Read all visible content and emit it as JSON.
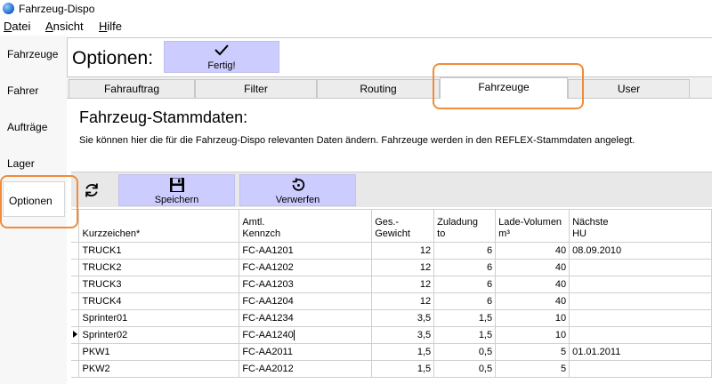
{
  "window": {
    "title": "Fahrzeug-Dispo"
  },
  "menu": [
    {
      "ul": "D",
      "rest": "atei"
    },
    {
      "ul": "A",
      "rest": "nsicht"
    },
    {
      "ul": "H",
      "rest": "ilfe"
    }
  ],
  "sidebar": {
    "items": [
      {
        "label": "Fahrzeuge"
      },
      {
        "label": "Fahrer"
      },
      {
        "label": "Aufträge"
      },
      {
        "label": "Lager"
      },
      {
        "label": "Optionen",
        "active": true
      }
    ]
  },
  "options": {
    "title": "Optionen:",
    "done_label": "Fertig!"
  },
  "tabs": [
    {
      "label": "Fahrauftrag"
    },
    {
      "label": "Filter"
    },
    {
      "label": "Routing"
    },
    {
      "label": "Fahrzeuge",
      "active": true
    },
    {
      "label": "User"
    }
  ],
  "section": {
    "title": "Fahrzeug-Stammdaten:",
    "description": "Sie können hier die für die Fahrzeug-Dispo relevanten Daten ändern. Fahrzeuge werden in den REFLEX-Stammdaten angelegt."
  },
  "toolbar": {
    "refresh_icon": "refresh-icon",
    "save_label": "Speichern",
    "discard_label": "Verwerfen"
  },
  "table": {
    "columns": [
      {
        "l1": "",
        "l2": "Kurzzeichen*"
      },
      {
        "l1": "Amtl.",
        "l2": "Kennzch"
      },
      {
        "l1": "Ges.-",
        "l2": "Gewicht"
      },
      {
        "l1": "Zuladung",
        "l2": "to"
      },
      {
        "l1": "Lade-Volumen",
        "l2": "m³"
      },
      {
        "l1": "Nächste",
        "l2": "HU"
      }
    ],
    "rows": [
      {
        "cells": [
          "TRUCK1",
          "FC-AA1201",
          "12",
          "6",
          "40",
          "08.09.2010"
        ]
      },
      {
        "cells": [
          "TRUCK2",
          "FC-AA1202",
          "12",
          "6",
          "40",
          ""
        ]
      },
      {
        "cells": [
          "TRUCK3",
          "FC-AA1203",
          "12",
          "6",
          "40",
          ""
        ]
      },
      {
        "cells": [
          "TRUCK4",
          "FC-AA1204",
          "12",
          "6",
          "40",
          ""
        ]
      },
      {
        "cells": [
          "Sprinter01",
          "FC-AA1234",
          "3,5",
          "1,5",
          "10",
          ""
        ]
      },
      {
        "cells": [
          "Sprinter02",
          "FC-AA1240",
          "3,5",
          "1,5",
          "10",
          ""
        ],
        "current": true
      },
      {
        "cells": [
          "PKW1",
          "FC-AA2011",
          "1,5",
          "0,5",
          "5",
          "01.01.2011"
        ]
      },
      {
        "cells": [
          "PKW2",
          "FC-AA2012",
          "1,5",
          "0,5",
          "5",
          ""
        ]
      }
    ]
  },
  "colors": {
    "button_bg": "#ccccff",
    "highlight": "#f08c3a"
  }
}
